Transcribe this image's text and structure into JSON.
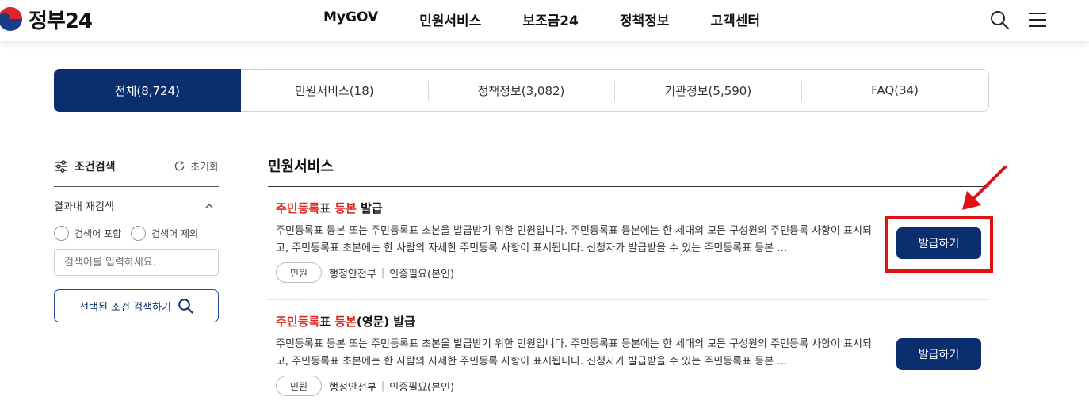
{
  "header": {
    "logo_text": "정부24",
    "nav": [
      "MyGOV",
      "민원서비스",
      "보조금24",
      "정책정보",
      "고객센터"
    ]
  },
  "tabs": [
    {
      "label": "전체(8,724)",
      "active": true
    },
    {
      "label": "민원서비스(18)",
      "active": false
    },
    {
      "label": "정책정보(3,082)",
      "active": false
    },
    {
      "label": "기관정보(5,590)",
      "active": false
    },
    {
      "label": "FAQ(34)",
      "active": false
    }
  ],
  "filter": {
    "title": "조건검색",
    "reset": "초기화",
    "refine_label": "결과내 재검색",
    "radio_include": "검색어 포함",
    "radio_exclude": "검색어 제외",
    "input_placeholder": "검색어를 입력하세요.",
    "search_button": "선택된 조건 검색하기"
  },
  "results": {
    "section_title": "민원서비스",
    "items": [
      {
        "title_parts": [
          {
            "text": "주민등록",
            "hl": true
          },
          {
            "text": "표 ",
            "hl": false
          },
          {
            "text": "등본",
            "hl": true
          },
          {
            "text": " 발급",
            "hl": false
          }
        ],
        "desc": "주민등록표 등본 또는 주민등록표 초본을 발급받기 위한 민원입니다. 주민등록표 등본에는 한 세대의 모든 구성원의 주민등록 사항이 표시되고, 주민등록표 초본에는 한 사람의 자세한 주민등록 사항이 표시됩니다. 신청자가 발급받을 수 있는 주민등록표 등본 …",
        "badge": "민원",
        "agency": "행정안전부",
        "auth": "인증필요(본인)",
        "button": "발급하기"
      },
      {
        "title_parts": [
          {
            "text": "주민등록",
            "hl": true
          },
          {
            "text": "표 ",
            "hl": false
          },
          {
            "text": "등본",
            "hl": true
          },
          {
            "text": "(영문) 발급",
            "hl": false
          }
        ],
        "desc": "주민등록표 등본 또는 주민등록표 초본을 발급받기 위한 민원입니다. 주민등록표 등본에는 한 세대의 모든 구성원의 주민등록 사항이 표시되고, 주민등록표 초본에는 한 사람의 자세한 주민등록 사항이 표시됩니다. 신청자가 발급받을 수 있는 주민등록표 등본 …",
        "badge": "민원",
        "agency": "행정안전부",
        "auth": "인증필요(본인)",
        "button": "발급하기"
      }
    ]
  },
  "colors": {
    "primary": "#0b2e6e",
    "highlight_text": "#e2231a",
    "annotation": "#e21111"
  }
}
